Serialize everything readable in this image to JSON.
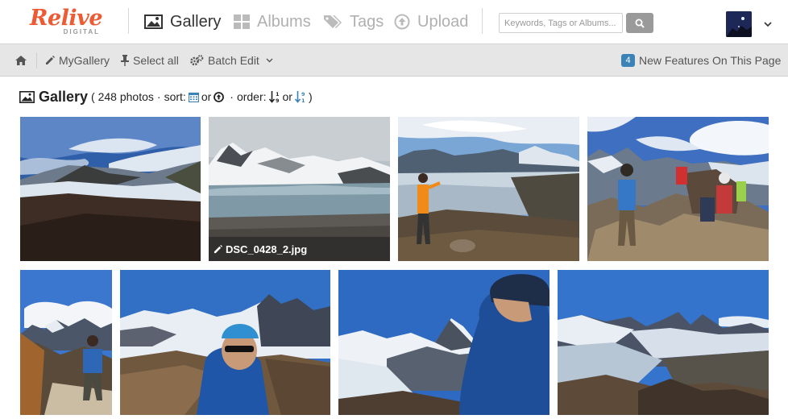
{
  "logo": {
    "main": "Relive",
    "sub": "DIGITAL"
  },
  "nav": [
    {
      "id": "gallery",
      "label": "Gallery",
      "icon": "image-icon",
      "active": true
    },
    {
      "id": "albums",
      "label": "Albums",
      "icon": "grid-icon",
      "active": false
    },
    {
      "id": "tags",
      "label": "Tags",
      "icon": "tag-icon",
      "active": false
    },
    {
      "id": "upload",
      "label": "Upload",
      "icon": "upload-icon",
      "active": false
    }
  ],
  "search": {
    "placeholder": "Keywords, Tags or Albums...",
    "value": ""
  },
  "toolbar": {
    "home_icon": "home-icon",
    "my_gallery": "MyGallery",
    "select_all": "Select all",
    "batch_edit": "Batch Edit",
    "new_features_count": "4",
    "new_features_label": "New Features On This Page"
  },
  "heading": {
    "title": "Gallery",
    "open": "(",
    "count": "248 photos",
    "dot1": "·",
    "sort_label": "sort:",
    "or1": "or",
    "dot2": "·",
    "order_label": "order:",
    "or2": "or",
    "close": ")"
  },
  "photos": [
    {
      "id": "p1",
      "caption": "",
      "scene": "glacier-lake"
    },
    {
      "id": "p2",
      "caption": "DSC_0428_2.jpg",
      "scene": "mountain-lake"
    },
    {
      "id": "p3",
      "caption": "",
      "scene": "hiker-glacier"
    },
    {
      "id": "p4",
      "caption": "",
      "scene": "group-summit"
    },
    {
      "id": "p5",
      "caption": "",
      "scene": "hiker-peaks"
    },
    {
      "id": "p6",
      "caption": "",
      "scene": "helmet-selfie"
    },
    {
      "id": "p7",
      "caption": "",
      "scene": "climber-fitzroy"
    },
    {
      "id": "p8",
      "caption": "",
      "scene": "fitzroy-panorama"
    }
  ],
  "colors": {
    "brand": "#ec5b34",
    "badge": "#3b82b6",
    "toolbar_bg": "#e6e6e6",
    "sort_icon": "#3b82b6"
  }
}
